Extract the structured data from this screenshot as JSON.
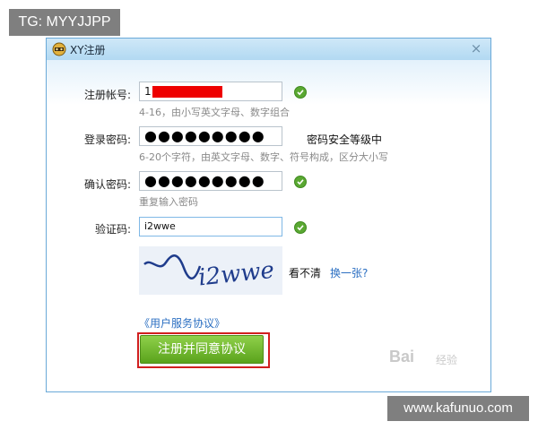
{
  "overlay": {
    "top_badge": "TG: MYYJJPP",
    "bottom_badge": "www.kafunuo.com",
    "watermark_logo": "Bai",
    "watermark_sub": "经验"
  },
  "window": {
    "title": "XY注册",
    "close_glyph": "×"
  },
  "form": {
    "account": {
      "label": "注册帐号:",
      "value": "1",
      "hint": "4-16，由小写英文字母、数字组合"
    },
    "password": {
      "label": "登录密码:",
      "value": "●●●●●●●●●",
      "strength": "密码安全等级中",
      "hint": "6-20个字符，由英文字母、数字、符号构成，区分大小写"
    },
    "confirm": {
      "label": "确认密码:",
      "value": "●●●●●●●●●",
      "hint": "重复输入密码"
    },
    "captcha": {
      "label": "验证码:",
      "value": "i2wwe",
      "image_text": "i2wwe",
      "unclear": "看不清",
      "refresh_link": "换一张?"
    },
    "agreement_link": "《用户服务协议》",
    "submit_label": "注册并同意协议"
  },
  "colors": {
    "accent_green": "#5aa31c",
    "highlight_red": "#d11f1f",
    "link_blue": "#2b6fc2"
  }
}
